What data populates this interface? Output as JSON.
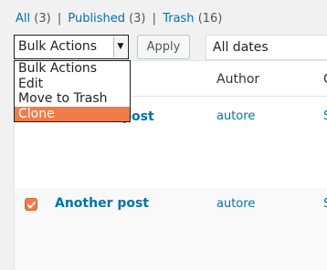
{
  "filters": {
    "all_label": "All",
    "all_count": "(3)",
    "published_label": "Published",
    "published_count": "(3)",
    "trash_label": "Trash",
    "trash_count": "(16)",
    "separator": "|"
  },
  "bulk_actions": {
    "selected": "Bulk Actions",
    "options": [
      "Bulk Actions",
      "Edit",
      "Move to Trash",
      "Clone"
    ],
    "highlighted_option": "Clone"
  },
  "apply_label": "Apply",
  "date_filter": {
    "selected": "All dates"
  },
  "table": {
    "columns": {
      "author": "Author",
      "partial": "C"
    },
    "rows": [
      {
        "title": "post",
        "author": "autore",
        "partial": "S",
        "checked": false
      },
      {
        "title": "Another post",
        "author": "autore",
        "partial": "S",
        "checked": true
      }
    ]
  },
  "colors": {
    "link": "#0073aa",
    "highlight": "#f07c48",
    "checkbox": "#f07c48"
  },
  "icons": {
    "select_arrow": "select-arrow-icon",
    "checkmark": "checkmark-icon"
  }
}
